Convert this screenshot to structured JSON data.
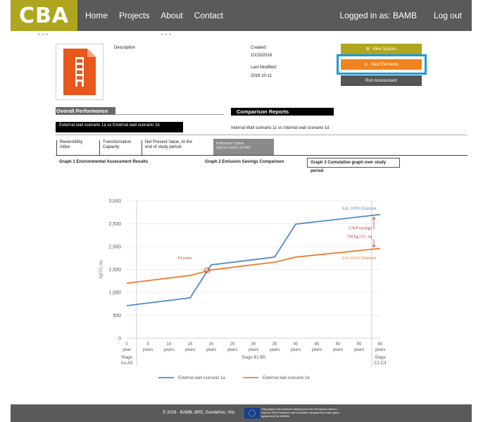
{
  "nav": {
    "logo": "CBA",
    "links": [
      "Home",
      "Projects",
      "About",
      "Contact"
    ],
    "user": "Logged in as: BAMB",
    "logout": "Log out"
  },
  "project": {
    "description_label": "Description",
    "created_label": "Created:",
    "created_value": "10/15/2018",
    "modified_label": "Last Modified:",
    "modified_value": "2018-10-11"
  },
  "actions": {
    "view_spaces": "View Spaces",
    "view_elements": "View Elements",
    "run_assessment": "Run Assessment"
  },
  "sections": {
    "overall": "Overall Performance",
    "comparison": "Comparison Reports",
    "scenario_left": "External wall scenario 1a vs External wall scenario 1b",
    "scenario_right": "Internal Wall scenario 1c vs Internal wall scenario 1d"
  },
  "metrics": {
    "reversibility_1": "Reversibility",
    "reversibility_2": "Index",
    "transformation_1": "Transformation",
    "transformation_2": "Capacity",
    "npv_1": "Net Present Value, At the",
    "npv_2": "end of study period",
    "carbon_1": "Embodied Carbon",
    "carbon_2": "(kgCo2 eq/m2 of GIA)"
  },
  "graphs": {
    "graph1": "Graph 1 Environmental Assessment Results",
    "graph2": "Graph 2 Emission Savings Comparison",
    "graph3": "Graph 3 Cumulative graph over study period"
  },
  "chart_data": {
    "type": "line",
    "ylabel": "kgCO₂ eq",
    "ylim": [
      0,
      3000
    ],
    "yticks": [
      0,
      500,
      1000,
      1500,
      2000,
      2500,
      3000
    ],
    "ytick_labels": [
      "0",
      "500",
      "1,000",
      "1,500",
      "2,000",
      "2,500",
      "3,000"
    ],
    "x": [
      0,
      5,
      10,
      15,
      20,
      25,
      30,
      35,
      40,
      45,
      50,
      55,
      60
    ],
    "x_tick_numbers": [
      "0",
      "5",
      "10",
      "15",
      "20",
      "25",
      "30",
      "35",
      "40",
      "45",
      "50",
      "55",
      "60"
    ],
    "x_tick_word_first": "year",
    "x_tick_word": "years",
    "stages": [
      {
        "line1": "Stage",
        "line2": "A1-A5",
        "x": 0
      },
      {
        "line1": "Stage B1-B5",
        "line2": "",
        "x": 30
      },
      {
        "line1": "Stage",
        "line2": "C1-C4",
        "x": 60
      }
    ],
    "series": [
      {
        "name": "External wall scenario 1a",
        "color": "#4f8ac9",
        "points": [
          [
            0,
            710
          ],
          [
            15,
            880
          ],
          [
            20,
            1600
          ],
          [
            35,
            1770
          ],
          [
            40,
            2490
          ],
          [
            60,
            2700
          ]
        ]
      },
      {
        "name": "External wall scenario 1b",
        "color": "#ee7d31",
        "points": [
          [
            0,
            1200
          ],
          [
            15,
            1370
          ],
          [
            20,
            1490
          ],
          [
            35,
            1660
          ],
          [
            40,
            1770
          ],
          [
            60,
            1960
          ]
        ]
      }
    ],
    "annotations": {
      "eol_top": "EoL 100% Disposal",
      "eol_bottom": "EoL 100% Disposal",
      "gwp_line1": "GWP savings",
      "gwp_line2": "740 kg CO₂ eq",
      "crossover": "19 years"
    }
  },
  "footer": {
    "copyright": "© 2018 - BAMB, BRE, SundaHus, Vito",
    "eu_text": "This project has received funding from the European Union's Horizon 2020 research and innovation programme under grant agreement No 642384"
  },
  "colors": {
    "nav_bg": "#5a5a5a",
    "brand": "#b0a51f",
    "accent": "#f0831e",
    "highlight": "#1a9ad9"
  }
}
